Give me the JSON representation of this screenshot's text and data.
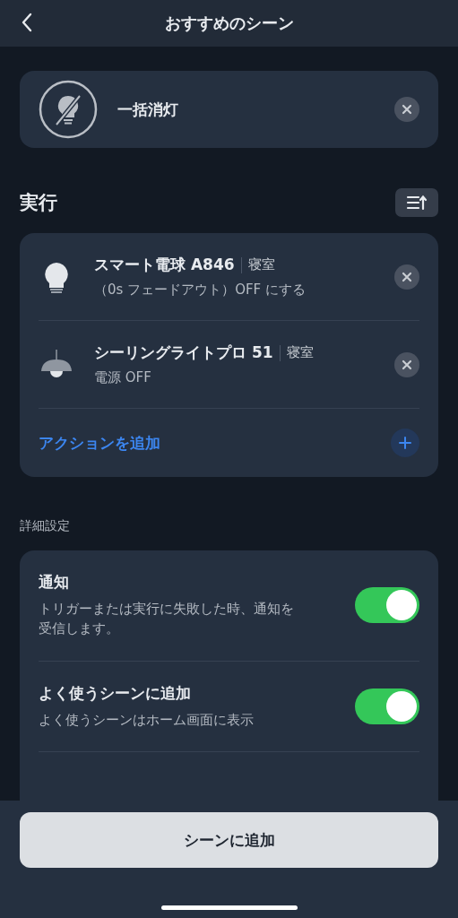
{
  "header": {
    "title": "おすすめのシーン"
  },
  "scene": {
    "name": "一括消灯"
  },
  "actions_section": {
    "title": "実行"
  },
  "actions": [
    {
      "kind": "bulb",
      "name": "スマート電球 A846",
      "room": "寝室",
      "detail": "（0s フェードアウト）OFF にする"
    },
    {
      "kind": "ceiling",
      "name": "シーリングライトプロ 51",
      "room": "寝室",
      "detail": "電源 OFF"
    }
  ],
  "add_action": {
    "label": "アクションを追加"
  },
  "settings_section": {
    "title": "詳細設定"
  },
  "settings": [
    {
      "title": "通知",
      "description": "トリガーまたは実行に失敗した時、通知を受信します。",
      "on": true
    },
    {
      "title": "よく使うシーンに追加",
      "description": "よく使うシーンはホーム画面に表示",
      "on": true
    }
  ],
  "bottom_button": {
    "label": "シーンに追加"
  }
}
